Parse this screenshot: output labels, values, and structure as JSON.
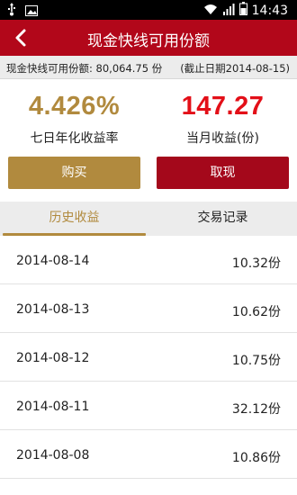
{
  "status_bar": {
    "time": "14:43",
    "icons": [
      "usb-icon",
      "image-icon",
      "wifi-icon",
      "signal-icon",
      "battery-icon"
    ]
  },
  "header": {
    "title": "现金快线可用份额",
    "back_icon": "chevron-left-icon"
  },
  "info": {
    "available_shares": "现金快线可用份额: 80,064.75 份",
    "cutoff_date": "(截止日期2014-08-15)"
  },
  "stats": {
    "yield_value": "4.426%",
    "yield_label": "七日年化收益率",
    "monthly_value": "147.27",
    "monthly_label": "当月收益(份)"
  },
  "actions": {
    "buy_label": "购买",
    "withdraw_label": "取现"
  },
  "tabs": {
    "history_label": "历史收益",
    "trades_label": "交易记录",
    "active": "history"
  },
  "history": [
    {
      "date": "2014-08-14",
      "amount": "10.32份"
    },
    {
      "date": "2014-08-13",
      "amount": "10.62份"
    },
    {
      "date": "2014-08-12",
      "amount": "10.75份"
    },
    {
      "date": "2014-08-11",
      "amount": "32.12份"
    },
    {
      "date": "2014-08-08",
      "amount": "10.86份"
    }
  ],
  "colors": {
    "brand_red": "#b2071a",
    "gold": "#b18a3e",
    "highlight_red": "#e30f18"
  }
}
